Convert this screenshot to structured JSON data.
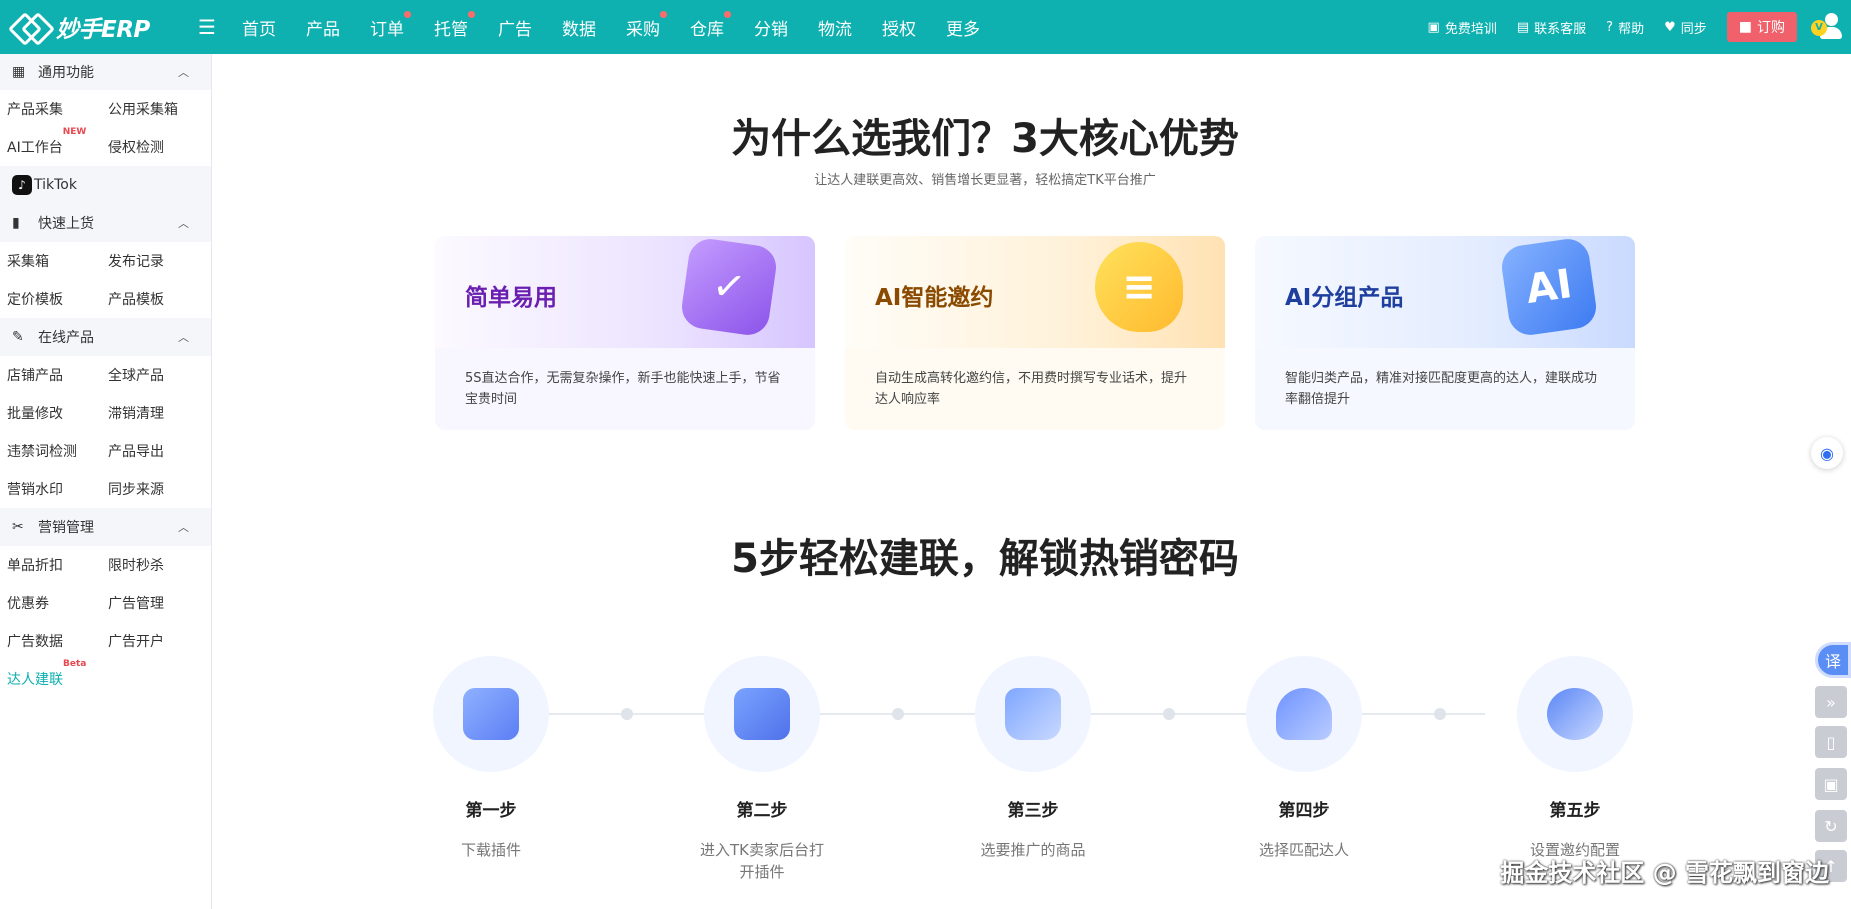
{
  "app": {
    "logo_text": "妙手ERP"
  },
  "nav": {
    "items": [
      {
        "label": "首页",
        "dot": false
      },
      {
        "label": "产品",
        "dot": false
      },
      {
        "label": "订单",
        "dot": true
      },
      {
        "label": "托管",
        "dot": true
      },
      {
        "label": "广告",
        "dot": false
      },
      {
        "label": "数据",
        "dot": false
      },
      {
        "label": "采购",
        "dot": true
      },
      {
        "label": "仓库",
        "dot": true
      },
      {
        "label": "分销",
        "dot": false
      },
      {
        "label": "物流",
        "dot": false
      },
      {
        "label": "授权",
        "dot": false
      },
      {
        "label": "更多",
        "dot": false
      }
    ],
    "right": {
      "training": "免费培训",
      "support": "联系客服",
      "help": "帮助",
      "sync": "同步",
      "order": "订购",
      "vip": "V"
    }
  },
  "sidebar": {
    "general": {
      "title": "通用功能",
      "rows": [
        [
          "产品采集",
          "公用采集箱"
        ],
        [
          "AI工作台",
          "侵权检测"
        ]
      ],
      "new_badge": "NEW",
      "tiktok": "TikTok"
    },
    "quick_upload": {
      "title": "快速上货",
      "rows": [
        [
          "采集箱",
          "发布记录"
        ],
        [
          "定价模板",
          "产品模板"
        ]
      ]
    },
    "online": {
      "title": "在线产品",
      "rows": [
        [
          "店铺产品",
          "全球产品"
        ],
        [
          "批量修改",
          "滞销清理"
        ],
        [
          "违禁词检测",
          "产品导出"
        ],
        [
          "营销水印",
          "同步来源"
        ]
      ]
    },
    "marketing": {
      "title": "营销管理",
      "rows": [
        [
          "单品折扣",
          "限时秒杀"
        ],
        [
          "优惠券",
          "广告管理"
        ],
        [
          "广告数据",
          "广告开户"
        ]
      ],
      "creator": "达人建联",
      "beta_badge": "Beta"
    }
  },
  "main": {
    "heading": "为什么选我们？3大核心优势",
    "subheading": "让达人建联更高效、销售增长更显著，轻松搞定TK平台推广",
    "cards": [
      {
        "title": "简单易用",
        "desc": "5S直达合作，无需复杂操作，新手也能快速上手，节省宝贵时间",
        "icon": "clock-check-icon"
      },
      {
        "title": "AI智能邀约",
        "desc": "自动生成高转化邀约信，不用费时撰写专业话术，提升达人响应率",
        "icon": "chat-bubble-icon"
      },
      {
        "title": "AI分组产品",
        "desc": "智能归类产品，精准对接匹配度更高的达人，建联成功率翻倍提升",
        "icon": "ai-chip-icon"
      }
    ],
    "steps_heading": "5步轻松建联，解锁热销密码",
    "steps": [
      {
        "title": "第一步",
        "desc": "下载插件"
      },
      {
        "title": "第二步",
        "desc": "进入TK卖家后台打开插件"
      },
      {
        "title": "第三步",
        "desc": "选要推广的商品"
      },
      {
        "title": "第四步",
        "desc": "选择匹配达人"
      },
      {
        "title": "第五步",
        "desc": "设置邀约配置"
      }
    ]
  },
  "floating": {
    "translate": "译"
  },
  "watermark": "掘金技术社区 @ 雪花飘到窗边",
  "colors": {
    "brand": "#0eb0b0",
    "order_button": "#f0616b",
    "active_link": "#0eb0b0"
  }
}
